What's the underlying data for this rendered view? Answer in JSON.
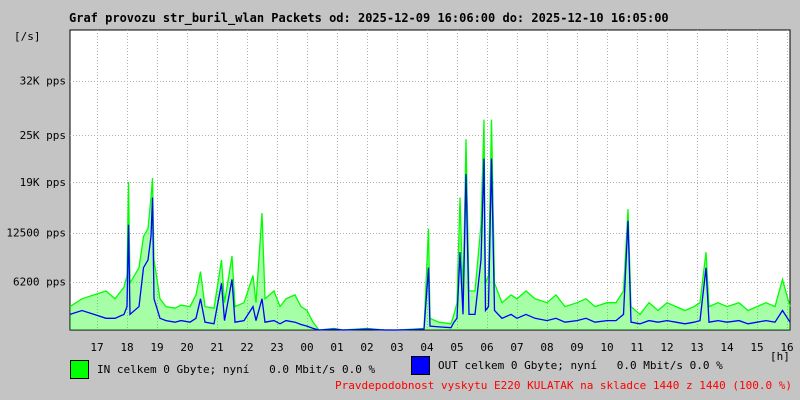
{
  "title": "Graf provozu str_buril_wlan Packets od: 2025-12-09 16:06:00 do: 2025-12-10 16:05:00",
  "colors": {
    "in": "#00ff00",
    "out": "#0000ff",
    "note": "#ff0000",
    "background": "#c4c4c4",
    "plot": "#ffffff"
  },
  "legend": {
    "in": "IN celkem 0 Gbyte; nyní   0.0 Mbit/s 0.0 %",
    "out": "OUT celkem 0 Gbyte; nyní   0.0 Mbit/s 0.0 %"
  },
  "note": "Pravdepodobnost vyskytu E220 KULATAK na skladce 1440 z 1440 (100.0 %)",
  "chart_data": {
    "type": "area",
    "title": "Graf provozu str_buril_wlan Packets od: 2025-12-09 16:06:00 do: 2025-12-10 16:05:00",
    "ylabel": "[/s]",
    "xlabel": "[h]",
    "ylim": [
      0,
      38500
    ],
    "xlim": [
      16.1,
      40.1
    ],
    "grid": true,
    "y_ticks": [
      {
        "value": 6200,
        "label": "6200 pps"
      },
      {
        "value": 12500,
        "label": "12500 pps"
      },
      {
        "value": 19000,
        "label": "19K pps"
      },
      {
        "value": 25000,
        "label": "25K pps"
      },
      {
        "value": 32000,
        "label": "32K pps"
      }
    ],
    "x_ticks": [
      {
        "value": 17,
        "label": "17"
      },
      {
        "value": 18,
        "label": "18"
      },
      {
        "value": 19,
        "label": "19"
      },
      {
        "value": 20,
        "label": "20"
      },
      {
        "value": 21,
        "label": "21"
      },
      {
        "value": 22,
        "label": "22"
      },
      {
        "value": 23,
        "label": "23"
      },
      {
        "value": 24,
        "label": "00"
      },
      {
        "value": 25,
        "label": "01"
      },
      {
        "value": 26,
        "label": "02"
      },
      {
        "value": 27,
        "label": "03"
      },
      {
        "value": 28,
        "label": "04"
      },
      {
        "value": 29,
        "label": "05"
      },
      {
        "value": 30,
        "label": "06"
      },
      {
        "value": 31,
        "label": "07"
      },
      {
        "value": 32,
        "label": "08"
      },
      {
        "value": 33,
        "label": "09"
      },
      {
        "value": 34,
        "label": "10"
      },
      {
        "value": 35,
        "label": "11"
      },
      {
        "value": 36,
        "label": "12"
      },
      {
        "value": 37,
        "label": "13"
      },
      {
        "value": 38,
        "label": "14"
      },
      {
        "value": 39,
        "label": "15"
      },
      {
        "value": 40,
        "label": "16"
      }
    ],
    "series": [
      {
        "name": "IN",
        "color": "#00ff00",
        "points": [
          [
            16.1,
            3000
          ],
          [
            16.5,
            4000
          ],
          [
            16.9,
            4500
          ],
          [
            17.3,
            5000
          ],
          [
            17.6,
            4000
          ],
          [
            17.9,
            5500
          ],
          [
            18.0,
            7000
          ],
          [
            18.05,
            19000
          ],
          [
            18.1,
            6000
          ],
          [
            18.4,
            8000
          ],
          [
            18.55,
            12000
          ],
          [
            18.7,
            13000
          ],
          [
            18.8,
            17000
          ],
          [
            18.85,
            19500
          ],
          [
            18.9,
            9000
          ],
          [
            19.1,
            4000
          ],
          [
            19.3,
            3000
          ],
          [
            19.6,
            2800
          ],
          [
            19.8,
            3200
          ],
          [
            20.1,
            3000
          ],
          [
            20.3,
            4500
          ],
          [
            20.45,
            7500
          ],
          [
            20.6,
            3000
          ],
          [
            20.9,
            2800
          ],
          [
            21.15,
            9000
          ],
          [
            21.25,
            3500
          ],
          [
            21.5,
            9500
          ],
          [
            21.6,
            3000
          ],
          [
            21.9,
            3500
          ],
          [
            22.2,
            7000
          ],
          [
            22.3,
            3500
          ],
          [
            22.5,
            15000
          ],
          [
            22.6,
            4000
          ],
          [
            22.9,
            5000
          ],
          [
            23.1,
            3000
          ],
          [
            23.3,
            4000
          ],
          [
            23.6,
            4500
          ],
          [
            23.8,
            3000
          ],
          [
            24.0,
            2500
          ],
          [
            24.2,
            1000
          ],
          [
            24.4,
            0
          ],
          [
            24.9,
            200
          ],
          [
            25.2,
            0
          ],
          [
            25.6,
            100
          ],
          [
            26.0,
            200
          ],
          [
            26.6,
            0
          ],
          [
            27.0,
            0
          ],
          [
            27.5,
            100
          ],
          [
            27.9,
            200
          ],
          [
            28.05,
            13000
          ],
          [
            28.1,
            1500
          ],
          [
            28.4,
            1000
          ],
          [
            28.8,
            800
          ],
          [
            28.9,
            2000
          ],
          [
            29.0,
            3500
          ],
          [
            29.1,
            17000
          ],
          [
            29.2,
            4000
          ],
          [
            29.3,
            24500
          ],
          [
            29.4,
            5000
          ],
          [
            29.6,
            5000
          ],
          [
            29.8,
            13500
          ],
          [
            29.9,
            27000
          ],
          [
            29.95,
            6000
          ],
          [
            30.05,
            7000
          ],
          [
            30.15,
            27000
          ],
          [
            30.25,
            6000
          ],
          [
            30.5,
            3500
          ],
          [
            30.8,
            4500
          ],
          [
            31.0,
            4000
          ],
          [
            31.3,
            5000
          ],
          [
            31.6,
            4000
          ],
          [
            32.0,
            3500
          ],
          [
            32.3,
            4500
          ],
          [
            32.6,
            3000
          ],
          [
            33.0,
            3500
          ],
          [
            33.3,
            4000
          ],
          [
            33.6,
            3000
          ],
          [
            34.0,
            3500
          ],
          [
            34.3,
            3500
          ],
          [
            34.55,
            5000
          ],
          [
            34.7,
            15500
          ],
          [
            34.8,
            3000
          ],
          [
            35.1,
            2000
          ],
          [
            35.4,
            3500
          ],
          [
            35.7,
            2500
          ],
          [
            36.0,
            3500
          ],
          [
            36.3,
            3000
          ],
          [
            36.6,
            2500
          ],
          [
            36.9,
            3000
          ],
          [
            37.1,
            3500
          ],
          [
            37.3,
            10000
          ],
          [
            37.4,
            3000
          ],
          [
            37.7,
            3500
          ],
          [
            38.0,
            3000
          ],
          [
            38.4,
            3500
          ],
          [
            38.7,
            2500
          ],
          [
            39.0,
            3000
          ],
          [
            39.3,
            3500
          ],
          [
            39.6,
            3000
          ],
          [
            39.85,
            6500
          ],
          [
            40.1,
            3000
          ]
        ]
      },
      {
        "name": "OUT",
        "color": "#0000ff",
        "points": [
          [
            16.1,
            2000
          ],
          [
            16.5,
            2500
          ],
          [
            16.9,
            2000
          ],
          [
            17.3,
            1500
          ],
          [
            17.6,
            1500
          ],
          [
            17.9,
            2000
          ],
          [
            18.0,
            3000
          ],
          [
            18.05,
            13500
          ],
          [
            18.1,
            2000
          ],
          [
            18.4,
            3000
          ],
          [
            18.55,
            8000
          ],
          [
            18.7,
            9000
          ],
          [
            18.8,
            12000
          ],
          [
            18.85,
            17000
          ],
          [
            18.9,
            4000
          ],
          [
            19.1,
            1500
          ],
          [
            19.3,
            1200
          ],
          [
            19.6,
            1000
          ],
          [
            19.8,
            1200
          ],
          [
            20.1,
            1000
          ],
          [
            20.3,
            1500
          ],
          [
            20.45,
            4000
          ],
          [
            20.6,
            1000
          ],
          [
            20.9,
            800
          ],
          [
            21.15,
            6000
          ],
          [
            21.25,
            1200
          ],
          [
            21.5,
            6500
          ],
          [
            21.6,
            1000
          ],
          [
            21.9,
            1200
          ],
          [
            22.2,
            3000
          ],
          [
            22.3,
            1200
          ],
          [
            22.5,
            4000
          ],
          [
            22.6,
            1000
          ],
          [
            22.9,
            1200
          ],
          [
            23.1,
            800
          ],
          [
            23.3,
            1200
          ],
          [
            23.6,
            1000
          ],
          [
            23.8,
            700
          ],
          [
            24.0,
            500
          ],
          [
            24.2,
            200
          ],
          [
            24.4,
            0
          ],
          [
            24.9,
            100
          ],
          [
            25.2,
            0
          ],
          [
            25.6,
            50
          ],
          [
            26.0,
            100
          ],
          [
            26.6,
            0
          ],
          [
            27.0,
            0
          ],
          [
            27.5,
            50
          ],
          [
            27.9,
            100
          ],
          [
            28.05,
            8000
          ],
          [
            28.1,
            500
          ],
          [
            28.4,
            400
          ],
          [
            28.8,
            300
          ],
          [
            28.9,
            1000
          ],
          [
            29.0,
            1500
          ],
          [
            29.1,
            10000
          ],
          [
            29.2,
            2000
          ],
          [
            29.3,
            20000
          ],
          [
            29.4,
            2000
          ],
          [
            29.6,
            2000
          ],
          [
            29.8,
            9000
          ],
          [
            29.9,
            22000
          ],
          [
            29.95,
            2500
          ],
          [
            30.05,
            3000
          ],
          [
            30.15,
            22000
          ],
          [
            30.25,
            2500
          ],
          [
            30.5,
            1500
          ],
          [
            30.8,
            2000
          ],
          [
            31.0,
            1500
          ],
          [
            31.3,
            2000
          ],
          [
            31.6,
            1500
          ],
          [
            32.0,
            1200
          ],
          [
            32.3,
            1500
          ],
          [
            32.6,
            1000
          ],
          [
            33.0,
            1200
          ],
          [
            33.3,
            1500
          ],
          [
            33.6,
            1000
          ],
          [
            34.0,
            1200
          ],
          [
            34.3,
            1200
          ],
          [
            34.55,
            2000
          ],
          [
            34.7,
            14000
          ],
          [
            34.8,
            1000
          ],
          [
            35.1,
            800
          ],
          [
            35.4,
            1200
          ],
          [
            35.7,
            1000
          ],
          [
            36.0,
            1200
          ],
          [
            36.3,
            1000
          ],
          [
            36.6,
            800
          ],
          [
            36.9,
            1000
          ],
          [
            37.1,
            1200
          ],
          [
            37.3,
            8000
          ],
          [
            37.4,
            1000
          ],
          [
            37.7,
            1200
          ],
          [
            38.0,
            1000
          ],
          [
            38.4,
            1200
          ],
          [
            38.7,
            800
          ],
          [
            39.0,
            1000
          ],
          [
            39.3,
            1200
          ],
          [
            39.6,
            1000
          ],
          [
            39.85,
            2500
          ],
          [
            40.1,
            1000
          ]
        ]
      }
    ]
  }
}
